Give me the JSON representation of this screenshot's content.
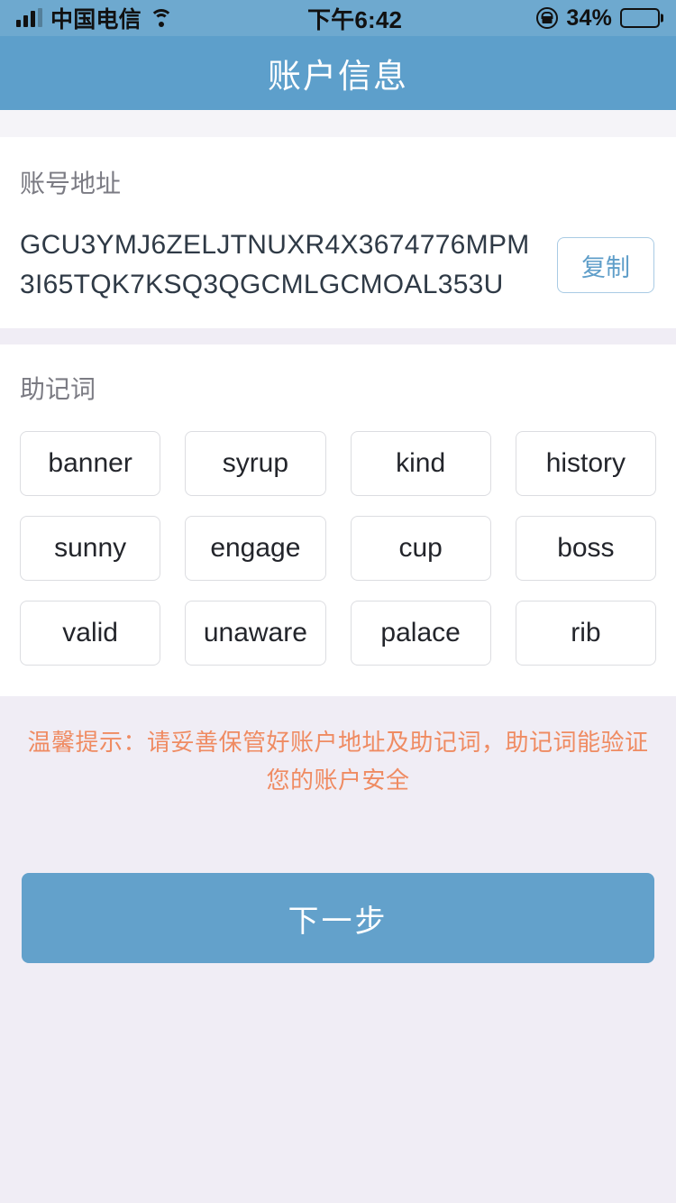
{
  "status_bar": {
    "carrier": "中国电信",
    "time": "下午6:42",
    "battery_percent": "34%",
    "icons": {
      "signal": "signal-bars-icon",
      "wifi": "wifi-icon",
      "rotation_lock": "rotation-lock-icon",
      "battery": "battery-icon"
    }
  },
  "header": {
    "title": "账户信息"
  },
  "account": {
    "label": "账号地址",
    "address": "GCU3YMJ6ZELJTNUXR4X3674776MPM3I65TQK7KSQ3QGCMLGCMOAL353U",
    "copy_label": "复制"
  },
  "mnemonic": {
    "label": "助记词",
    "words": [
      "banner",
      "syrup",
      "kind",
      "history",
      "sunny",
      "engage",
      "cup",
      "boss",
      "valid",
      "unaware",
      "palace",
      "rib"
    ]
  },
  "tip": {
    "text": "温馨提示：请妥善保管好账户地址及助记词，助记词能验证您的账户安全"
  },
  "actions": {
    "next_label": "下一步"
  },
  "colors": {
    "header_blue": "#5d9fcb",
    "status_blue": "#6ea9cf",
    "page_bg": "#f0edf5",
    "card_white": "#ffffff",
    "tip_orange": "#ef8b62",
    "copy_border": "#a9cbe4",
    "copy_text": "#5f9ec9",
    "chip_border": "#dcdde1",
    "label_gray": "#7b7b83",
    "address_text": "#2f3a46",
    "next_blue": "#63a1cb"
  }
}
